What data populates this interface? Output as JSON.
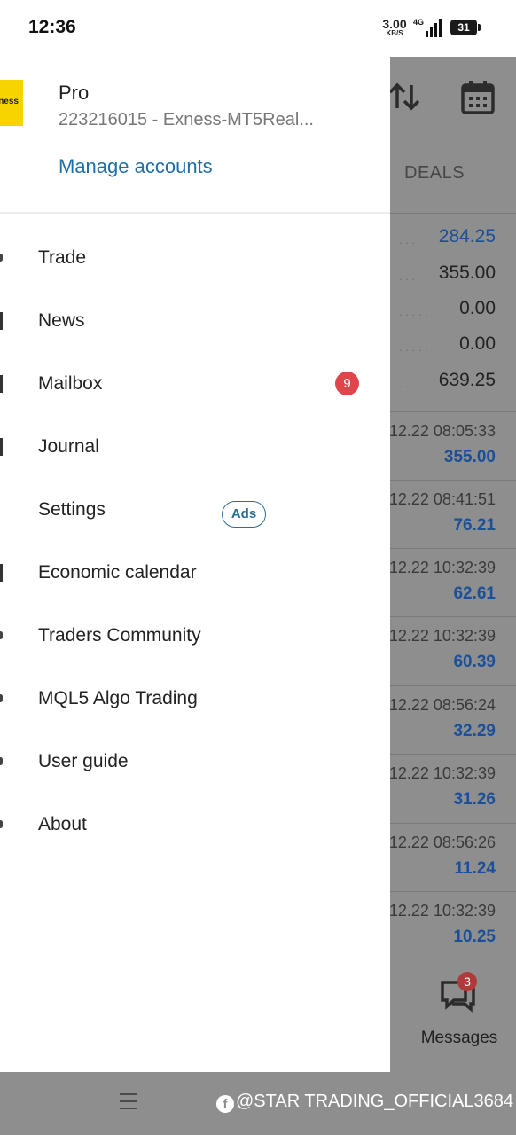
{
  "status_bar": {
    "time": "12:36",
    "net_speed": "3.00",
    "net_speed_unit": "KB/S",
    "network_type": "4G",
    "battery": "31"
  },
  "account": {
    "logo_text": "ness",
    "type": "Pro",
    "id_line": "223216015 - Exness-MT5Real...",
    "manage_label": "Manage accounts"
  },
  "menu": [
    {
      "label": "Trade",
      "icon": "trade-icon"
    },
    {
      "label": "News",
      "icon": "news-icon"
    },
    {
      "label": "Mailbox",
      "icon": "mailbox-icon"
    },
    {
      "label": "Journal",
      "icon": "journal-icon"
    },
    {
      "label": "Settings",
      "icon": "settings-icon"
    },
    {
      "label": "Economic calendar",
      "icon": "calendar-icon"
    },
    {
      "label": "Traders Community",
      "icon": "community-icon"
    },
    {
      "label": "MQL5 Algo Trading",
      "icon": "algo-icon"
    },
    {
      "label": "User guide",
      "icon": "user-guide-icon"
    },
    {
      "label": "About",
      "icon": "about-icon"
    }
  ],
  "mailbox_badge": "9",
  "ads_label": "Ads",
  "background": {
    "tab_label": "DEALS",
    "summary": [
      "284.25",
      "355.00",
      "0.00",
      "0.00",
      "639.25"
    ],
    "deals": [
      {
        "time": ".12.22 08:05:33",
        "amount": "355.00"
      },
      {
        "time": ".12.22 08:41:51",
        "amount": "76.21"
      },
      {
        "time": ".12.22 10:32:39",
        "amount": "62.61"
      },
      {
        "time": ".12.22 10:32:39",
        "amount": "60.39"
      },
      {
        "time": ".12.22 08:56:24",
        "amount": "32.29"
      },
      {
        "time": ".12.22 10:32:39",
        "amount": "31.26"
      },
      {
        "time": ".12.22 08:56:26",
        "amount": "11.24"
      },
      {
        "time": ".12.22 10:32:39",
        "amount": "10.25"
      }
    ],
    "messages_label": "Messages",
    "messages_badge": "3"
  },
  "watermark": "@STAR TRADING_OFFICIAL3684",
  "colors": {
    "accent_blue": "#1e6fa8",
    "badge_red": "#e0454b",
    "logo_yellow": "#f7d300",
    "dim_overlay": "#8e8e8e"
  }
}
